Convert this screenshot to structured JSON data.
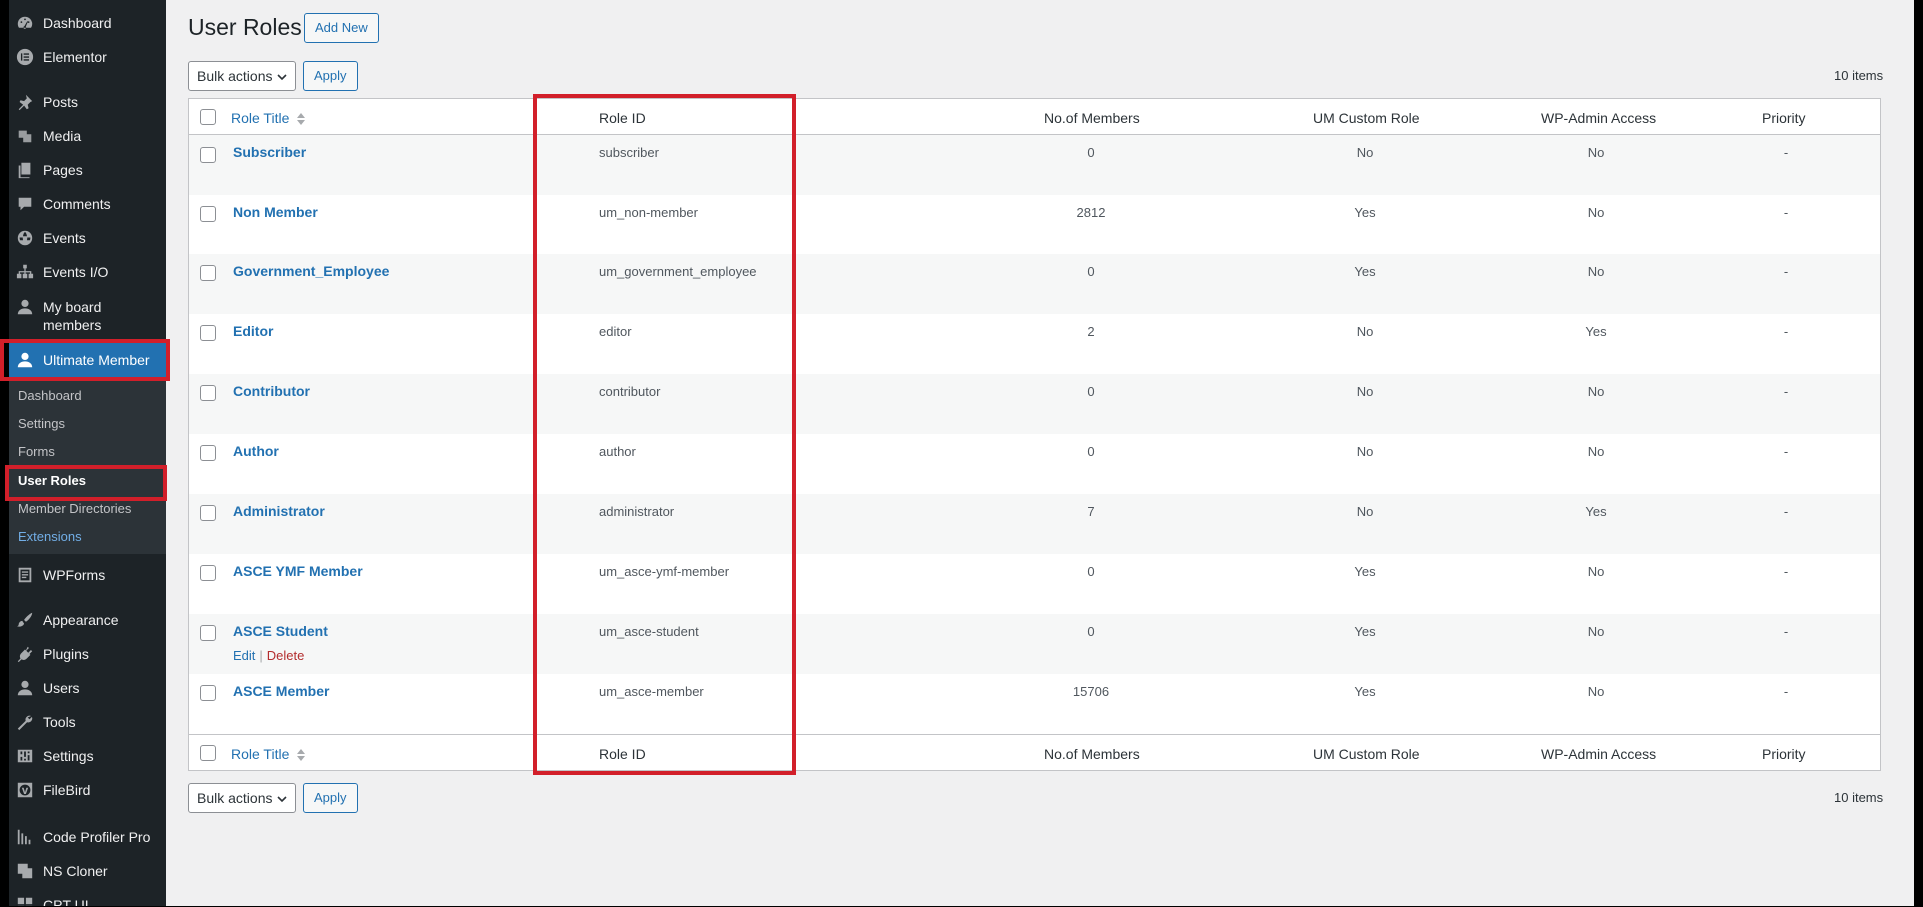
{
  "sidebar": {
    "items": [
      {
        "label": "Dashboard",
        "icon": "dashboard-icon"
      },
      {
        "label": "Elementor",
        "icon": "elementor-icon"
      },
      {
        "label": "Posts",
        "icon": "pin-icon"
      },
      {
        "label": "Media",
        "icon": "media-icon"
      },
      {
        "label": "Pages",
        "icon": "pages-icon"
      },
      {
        "label": "Comments",
        "icon": "comments-icon"
      },
      {
        "label": "Events",
        "icon": "globe-icon"
      },
      {
        "label": "Events I/O",
        "icon": "sitemap-icon"
      },
      {
        "label": "My board members",
        "icon": "user-icon"
      },
      {
        "label": "Ultimate Member",
        "icon": "user-icon"
      },
      {
        "label": "WPForms",
        "icon": "forms-icon"
      },
      {
        "label": "Appearance",
        "icon": "brush-icon"
      },
      {
        "label": "Plugins",
        "icon": "plugin-icon"
      },
      {
        "label": "Users",
        "icon": "users-icon"
      },
      {
        "label": "Tools",
        "icon": "wrench-icon"
      },
      {
        "label": "Settings",
        "icon": "settings-icon"
      },
      {
        "label": "FileBird",
        "icon": "wordpress-icon"
      },
      {
        "label": "Code Profiler Pro",
        "icon": "bar-chart-icon"
      },
      {
        "label": "NS Cloner",
        "icon": "clone-icon"
      },
      {
        "label": "CPT UI",
        "icon": "cpt-icon"
      }
    ],
    "submenu": [
      "Dashboard",
      "Settings",
      "Forms",
      "User Roles",
      "Member Directories",
      "Extensions"
    ]
  },
  "header": {
    "title": "User Roles",
    "add_new": "Add New"
  },
  "toolbar": {
    "bulk_label": "Bulk actions",
    "apply_label": "Apply",
    "items_count": "10 items"
  },
  "table": {
    "columns": [
      "Role Title",
      "Role ID",
      "No.of Members",
      "UM Custom Role",
      "WP-Admin Access",
      "Priority"
    ],
    "rows": [
      {
        "title": "Subscriber",
        "id": "subscriber",
        "members": "0",
        "custom": "No",
        "admin": "No",
        "priority": "-"
      },
      {
        "title": "Non Member",
        "id": "um_non-member",
        "members": "2812",
        "custom": "Yes",
        "admin": "No",
        "priority": "-"
      },
      {
        "title": "Government_Employee",
        "id": "um_government_employee",
        "members": "0",
        "custom": "Yes",
        "admin": "No",
        "priority": "-"
      },
      {
        "title": "Editor",
        "id": "editor",
        "members": "2",
        "custom": "No",
        "admin": "Yes",
        "priority": "-"
      },
      {
        "title": "Contributor",
        "id": "contributor",
        "members": "0",
        "custom": "No",
        "admin": "No",
        "priority": "-"
      },
      {
        "title": "Author",
        "id": "author",
        "members": "0",
        "custom": "No",
        "admin": "No",
        "priority": "-"
      },
      {
        "title": "Administrator",
        "id": "administrator",
        "members": "7",
        "custom": "No",
        "admin": "Yes",
        "priority": "-"
      },
      {
        "title": "ASCE YMF Member",
        "id": "um_asce-ymf-member",
        "members": "0",
        "custom": "Yes",
        "admin": "No",
        "priority": "-"
      },
      {
        "title": "ASCE Student",
        "id": "um_asce-student",
        "members": "0",
        "custom": "Yes",
        "admin": "No",
        "priority": "-"
      },
      {
        "title": "ASCE Member",
        "id": "um_asce-member",
        "members": "15706",
        "custom": "Yes",
        "admin": "No",
        "priority": "-"
      }
    ],
    "row_actions": {
      "edit": "Edit",
      "separator": "|",
      "delete": "Delete"
    }
  },
  "colors": {
    "sidebar_bg": "#1d2327",
    "accent": "#2271b1",
    "highlight_red": "#d21f2a"
  }
}
